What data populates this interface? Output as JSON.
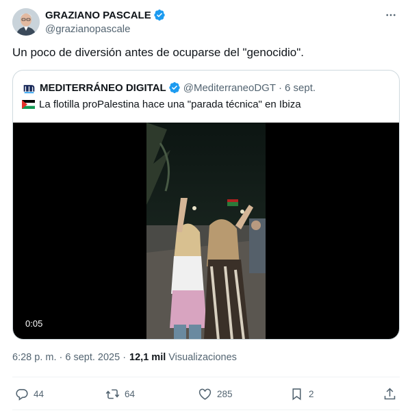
{
  "author": {
    "name": "GRAZIANO PASCALE",
    "handle": "@grazianopascale"
  },
  "tweet": {
    "text": "Un poco de diversión antes de ocuparse del \"genocidio\"."
  },
  "quote": {
    "name": "MEDITERRÁNEO DIGITAL",
    "handle": "@MediterraneoDGT",
    "separator": "·",
    "date": "6 sept.",
    "text": "La flotilla proPalestina hace una \"parada técnica\" en Ibiza",
    "video_duration": "0:05"
  },
  "meta": {
    "time_date": "6:28 p. m. · 6 sept. 2025 ·",
    "views_count": "12,1 mil",
    "views_label": "Visualizaciones"
  },
  "actions": {
    "replies": "44",
    "reposts": "64",
    "likes": "285",
    "bookmarks": "2"
  },
  "colors": {
    "verified": "#1d9bf0",
    "secondary_text": "#536471",
    "border": "#cfd9de"
  },
  "icons": [
    "verified-badge-icon",
    "more-icon",
    "reply-icon",
    "repost-icon",
    "like-icon",
    "bookmark-icon",
    "share-icon",
    "palestine-flag-icon",
    "mediterraneo-logo-icon"
  ]
}
